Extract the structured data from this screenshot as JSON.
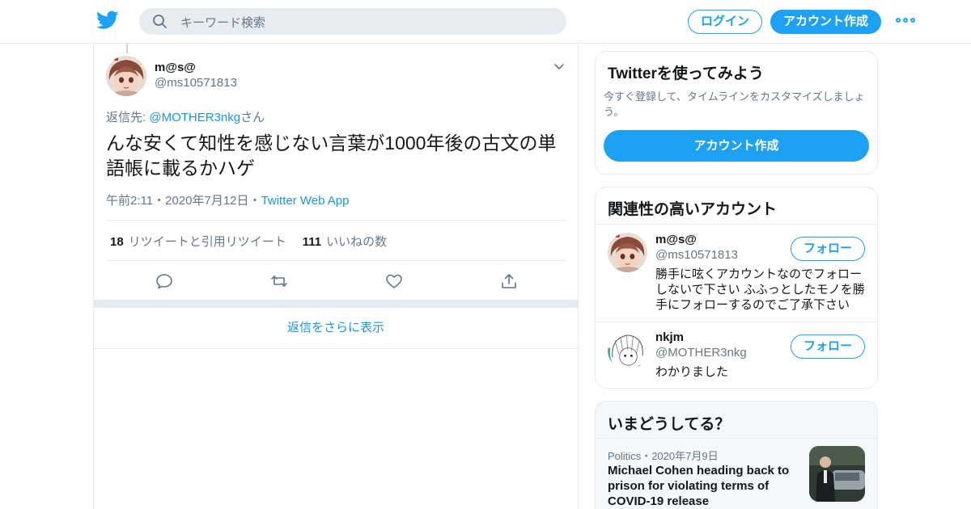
{
  "header": {
    "search_placeholder": "キーワード検索",
    "login_label": "ログイン",
    "signup_label": "アカウント作成"
  },
  "tweet": {
    "author_name": "m@s@",
    "author_handle": "@ms10571813",
    "reply_prefix": "返信先: ",
    "reply_mention": "@MOTHER3nkg",
    "reply_suffix": "さん",
    "text": "んな安くて知性を感じない言葉が1000年後の古文の単語帳に載るかハゲ",
    "time": "午前2:11",
    "date": "2020年7月12日",
    "dot": "・",
    "app": "Twitter Web App",
    "retweets_count": "18",
    "retweets_label": "リツイートと引用リツイート",
    "likes_count": "111",
    "likes_label": "いいねの数",
    "more_replies": "返信をさらに表示"
  },
  "sidebar": {
    "promo": {
      "title": "Twitterを使ってみよう",
      "description": "今すぐ登録して、タイムラインをカスタマイズしましょう。",
      "button": "アカウント作成"
    },
    "related": {
      "title": "関連性の高いアカウント",
      "accounts": [
        {
          "name": "m@s@",
          "handle": "@ms10571813",
          "bio": "勝手に呟くアカウントなのでフォローしないで下さい ふふっとしたモノを勝手にフォローするのでご了承下さい",
          "follow": "フォロー"
        },
        {
          "name": "nkjm",
          "handle": "@MOTHER3nkg",
          "bio": "わかりました",
          "follow": "フォロー"
        }
      ]
    },
    "trends": {
      "title": "いまどうしてる？",
      "category": "Politics",
      "dot": "・",
      "date": "2020年7月9日",
      "headline": "Michael Cohen heading back to prison for violating terms of COVID-19 release"
    }
  },
  "colors": {
    "accent": "#1da1f2",
    "link": "#1b95e0",
    "secondary_text": "#657786",
    "border": "#e6ecf0"
  },
  "icons": [
    "twitter-logo-icon",
    "search-icon",
    "more-icon",
    "chevron-down-icon",
    "reply-icon",
    "retweet-icon",
    "like-icon",
    "share-icon"
  ]
}
